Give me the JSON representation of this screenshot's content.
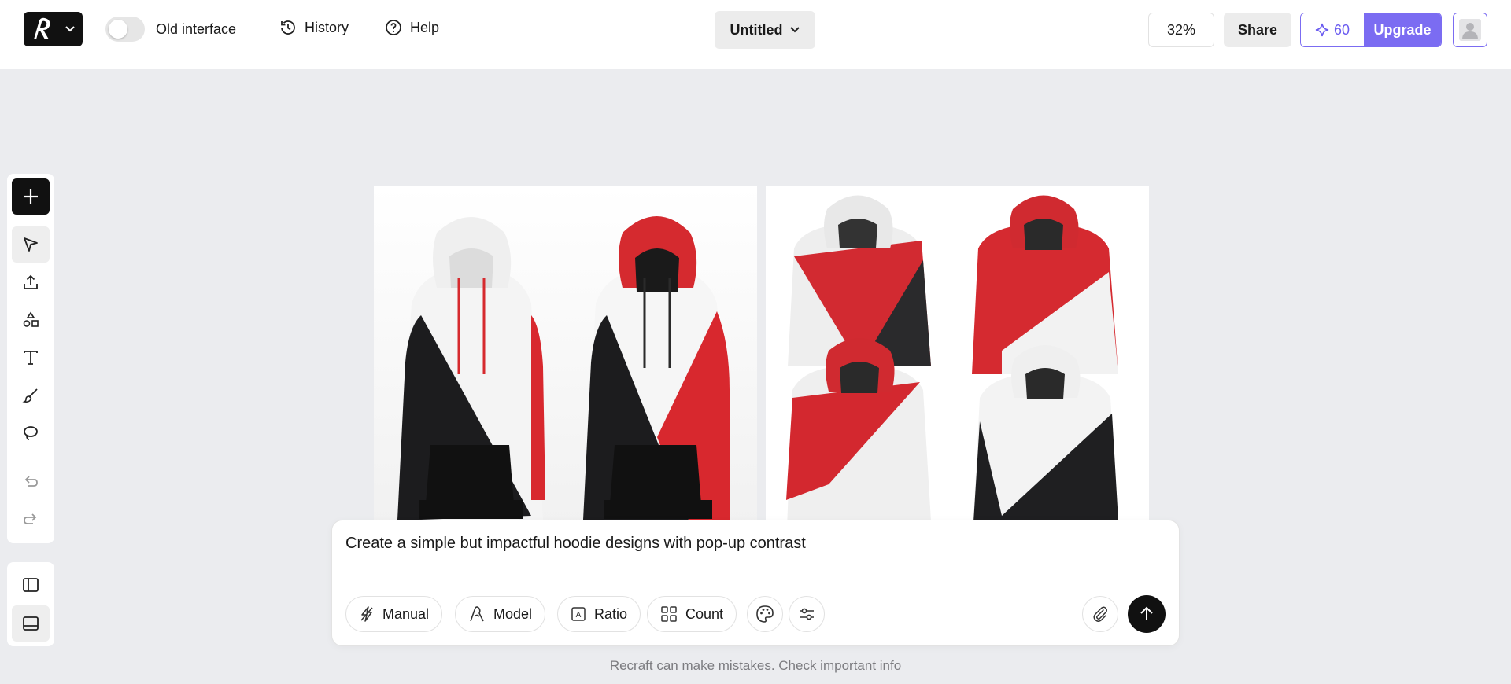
{
  "header": {
    "old_interface_label": "Old interface",
    "history_label": "History",
    "help_label": "Help",
    "project_title": "Untitled",
    "zoom": "32%",
    "share_label": "Share",
    "credits": "60",
    "upgrade_label": "Upgrade",
    "accent_color": "#7b6cf2"
  },
  "toolbar": {
    "tools": [
      "add-icon",
      "select-icon",
      "upload-icon",
      "shapes-icon",
      "text-icon",
      "brush-icon",
      "lasso-icon",
      "undo-icon",
      "redo-icon"
    ],
    "panel_tools": [
      "left-panel-icon",
      "bottom-panel-icon"
    ]
  },
  "canvas": {
    "images": [
      "hoodie-pair-image",
      "hoodie-grid-image"
    ]
  },
  "prompt": {
    "text": "Create a simple but impactful hoodie designs with pop-up contrast",
    "manual_label": "Manual",
    "model_label": "Model",
    "ratio_label": "Ratio",
    "count_label": "Count"
  },
  "footer": {
    "disclaimer": "Recraft can make mistakes. Check important info"
  }
}
